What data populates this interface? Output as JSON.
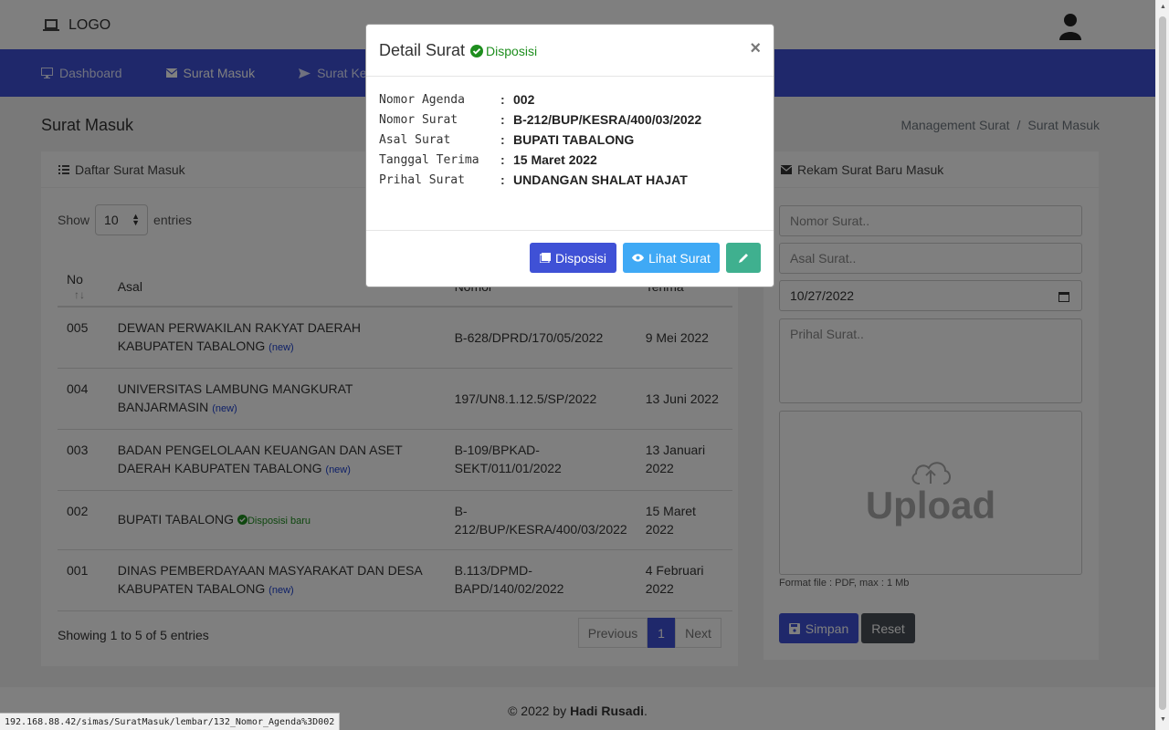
{
  "topbar": {
    "logo_text": "LOGO"
  },
  "nav": [
    {
      "label": "Dashboard",
      "icon": "monitor-icon"
    },
    {
      "label": "Surat Masuk",
      "icon": "envelope-icon"
    },
    {
      "label": "Surat Keluar",
      "icon": "send-icon"
    }
  ],
  "page": {
    "title": "Surat Masuk",
    "breadcrumb": [
      "Management Surat",
      "/",
      "Surat Masuk"
    ]
  },
  "list_card": {
    "title": "Daftar Surat Masuk",
    "show_label": "Show",
    "show_value": "10",
    "entries_label": "entries",
    "columns": [
      "No",
      "Asal",
      "Nomor",
      "Terima"
    ],
    "rows": [
      {
        "no": "005",
        "asal": "DEWAN PERWAKILAN RAKYAT DAERAH KABUPATEN TABALONG",
        "tag": "(new)",
        "nomor": "B-628/DPRD/170/05/2022",
        "terima": "9 Mei 2022"
      },
      {
        "no": "004",
        "asal": "UNIVERSITAS LAMBUNG MANGKURAT BANJARMASIN",
        "tag": "(new)",
        "nomor": "197/UN8.1.12.5/SP/2022",
        "terima": "13 Juni 2022"
      },
      {
        "no": "003",
        "asal": "BADAN PENGELOLAAN KEUANGAN DAN ASET DAERAH KABUPATEN TABALONG",
        "tag": "(new)",
        "nomor": "B-109/BPKAD-SEKT/011/01/2022",
        "terima": "13 Januari 2022"
      },
      {
        "no": "002",
        "asal": "BUPATI TABALONG",
        "tag": "Disposisi baru",
        "nomor": "B-212/BUP/KESRA/400/03/2022",
        "terima": "15 Maret 2022"
      },
      {
        "no": "001",
        "asal": "DINAS PEMBERDAYAAN MASYARAKAT DAN DESA KABUPATEN TABALONG",
        "tag": "(new)",
        "nomor": "B.113/DPMD-BAPD/140/02/2022",
        "terima": "4 Februari 2022"
      }
    ],
    "showing_text": "Showing 1 to 5 of 5 entries",
    "pager": {
      "prev": "Previous",
      "current": "1",
      "next": "Next"
    }
  },
  "form_card": {
    "title": "Rekam Surat Baru Masuk",
    "nomor_placeholder": "Nomor Surat..",
    "asal_placeholder": "Asal Surat..",
    "date_value": "10/27/2022",
    "prihal_placeholder": "Prihal Surat..",
    "upload_text": "Upload",
    "format_note": "Format file : PDF, max : 1 Mb",
    "simpan_label": "Simpan",
    "reset_label": "Reset"
  },
  "footer": {
    "prefix": "© 2022 by",
    "author": "Hadi Rusadi",
    "suffix": "."
  },
  "modal": {
    "title": "Detail Surat",
    "status": "Disposisi",
    "close": "×",
    "details": [
      {
        "label": "Nomor Agenda",
        "value": "002"
      },
      {
        "label": "Nomor Surat",
        "value": "B-212/BUP/KESRA/400/03/2022"
      },
      {
        "label": "Asal Surat",
        "value": "BUPATI TABALONG"
      },
      {
        "label": "Tanggal Terima",
        "value": "15 Maret 2022"
      },
      {
        "label": "Prihal Surat",
        "value": "UNDANGAN SHALAT HAJAT"
      }
    ],
    "buttons": {
      "disposisi": "Disposisi",
      "lihat": "Lihat Surat"
    }
  },
  "status_url": "192.168.88.42/simas/SuratMasuk/lembar/132_Nomor_Agenda%3D002",
  "colors": {
    "primary": "#3f51d6",
    "info": "#3fa9f5",
    "success": "#3fb08f",
    "status_green": "#1e8e1e"
  }
}
